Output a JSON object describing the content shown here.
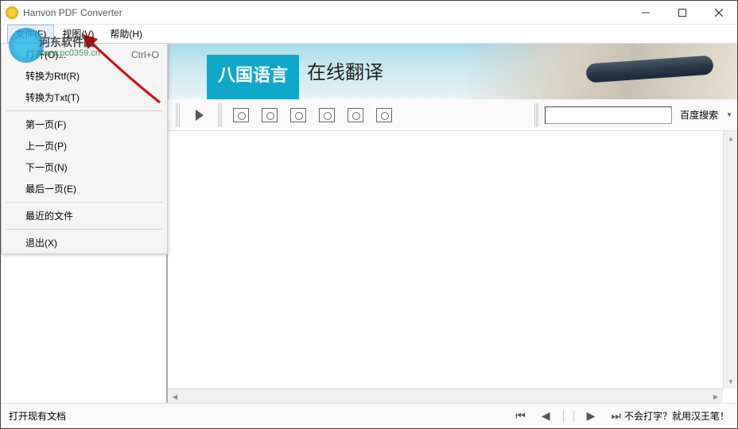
{
  "titlebar": {
    "text": "Hanvon PDF Converter"
  },
  "menubar": {
    "file": "文件(F)",
    "view": "视图(V)",
    "help": "帮助(H)"
  },
  "file_menu": {
    "open": {
      "label": "打开(O)...",
      "shortcut": "Ctrl+O"
    },
    "to_rtf": "转换为Rtf(R)",
    "to_txt": "转换为Txt(T)",
    "first_page": "第一页(F)",
    "prev_page": "上一页(P)",
    "next_page": "下一页(N)",
    "last_page": "最后一页(E)",
    "recent": "最近的文件",
    "exit": "退出(X)"
  },
  "banner": {
    "badge": "八国语言",
    "text": "在线翻译"
  },
  "search": {
    "placeholder": "",
    "engine": "百度搜索"
  },
  "statusbar": {
    "left": "打开现有文档",
    "right": "不会打字？就用汉王笔！"
  },
  "watermark": {
    "text": "河东软件园",
    "url": "www.pc0359.cn"
  }
}
